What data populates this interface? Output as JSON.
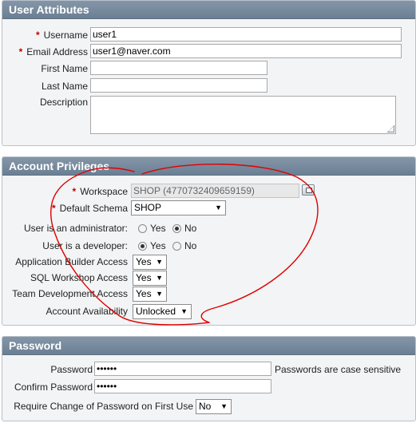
{
  "user_attributes": {
    "title": "User Attributes",
    "username": {
      "label": "Username",
      "value": "user1"
    },
    "email": {
      "label": "Email Address",
      "value": "user1@naver.com"
    },
    "first_name": {
      "label": "First Name",
      "value": ""
    },
    "last_name": {
      "label": "Last Name",
      "value": ""
    },
    "description": {
      "label": "Description",
      "value": ""
    }
  },
  "account_privileges": {
    "title": "Account Privileges",
    "workspace": {
      "label": "Workspace",
      "value": "SHOP (4770732409659159)"
    },
    "default_schema": {
      "label": "Default Schema",
      "value": "SHOP"
    },
    "is_admin": {
      "label": "User is an administrator:",
      "yes": "Yes",
      "no": "No",
      "selected": "No"
    },
    "is_developer": {
      "label": "User is a developer:",
      "yes": "Yes",
      "no": "No",
      "selected": "Yes"
    },
    "app_builder_access": {
      "label": "Application Builder Access",
      "value": "Yes"
    },
    "sql_workshop_access": {
      "label": "SQL Workshop Access",
      "value": "Yes"
    },
    "team_dev_access": {
      "label": "Team Development Access",
      "value": "Yes"
    },
    "account_availability": {
      "label": "Account Availability",
      "value": "Unlocked"
    }
  },
  "password": {
    "title": "Password",
    "password": {
      "label": "Password",
      "value": "••••••",
      "note": "Passwords are case sensitive"
    },
    "confirm_password": {
      "label": "Confirm Password",
      "value": "••••••"
    },
    "require_change": {
      "label": "Require Change of Password on First Use",
      "value": "No"
    }
  },
  "colors": {
    "header_bg": "#7589a0",
    "required_marker": "#c00000",
    "annotation_stroke": "#e00000"
  }
}
